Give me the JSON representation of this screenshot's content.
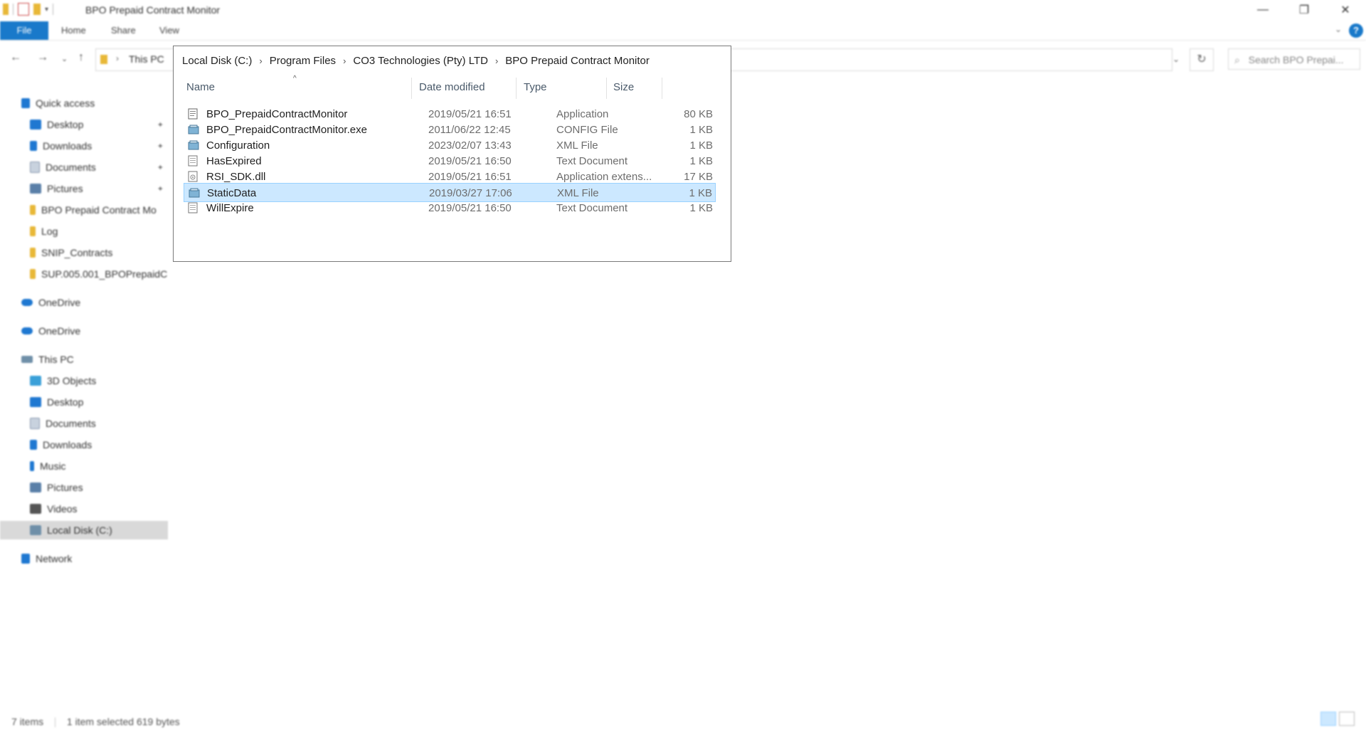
{
  "window": {
    "title": "BPO Prepaid Contract Monitor",
    "controls": [
      "—",
      "❐",
      "✕"
    ]
  },
  "ribbon": {
    "tabs": [
      "File",
      "Home",
      "Share",
      "View"
    ],
    "help": "?"
  },
  "address": {
    "this_pc": "This PC",
    "search_placeholder": "Search BPO Prepai..."
  },
  "sidebar": {
    "quick_access": "Quick access",
    "quick_items": [
      {
        "label": "Desktop",
        "icon": "desktop-icon",
        "color": "#1f78d1",
        "pinned": true
      },
      {
        "label": "Downloads",
        "icon": "download-icon",
        "color": "#1f78d1",
        "pinned": true
      },
      {
        "label": "Documents",
        "icon": "documents-icon",
        "color": "#8a9bb0",
        "pinned": true
      },
      {
        "label": "Pictures",
        "icon": "pictures-icon",
        "color": "#5a7fa8",
        "pinned": true
      },
      {
        "label": "BPO Prepaid Contract Mo",
        "icon": "folder-icon",
        "color": "#e8b838",
        "pinned": false
      },
      {
        "label": "Log",
        "icon": "folder-icon",
        "color": "#e8b838",
        "pinned": false
      },
      {
        "label": "SNIP_Contracts",
        "icon": "folder-icon",
        "color": "#e8b838",
        "pinned": false
      },
      {
        "label": "SUP.005.001_BPOPrepaidC",
        "icon": "folder-icon",
        "color": "#e8b838",
        "pinned": false
      }
    ],
    "onedrive_1": "OneDrive",
    "onedrive_2": "OneDrive",
    "this_pc": "This PC",
    "pc_items": [
      {
        "label": "3D Objects",
        "icon": "3d-objects-icon",
        "color": "#3aa0d8"
      },
      {
        "label": "Desktop",
        "icon": "desktop-icon",
        "color": "#1f78d1"
      },
      {
        "label": "Documents",
        "icon": "documents-icon",
        "color": "#8a9bb0"
      },
      {
        "label": "Downloads",
        "icon": "download-icon",
        "color": "#1f78d1"
      },
      {
        "label": "Music",
        "icon": "music-icon",
        "color": "#1f78d1"
      },
      {
        "label": "Pictures",
        "icon": "pictures-icon",
        "color": "#5a7fa8"
      },
      {
        "label": "Videos",
        "icon": "videos-icon",
        "color": "#555555"
      },
      {
        "label": "Local Disk (C:)",
        "icon": "local-disk-icon",
        "color": "#6f8fa8"
      }
    ],
    "network": "Network"
  },
  "breadcrumb": [
    "Local Disk (C:)",
    "Program Files",
    "CO3 Technologies (Pty) LTD",
    "BPO Prepaid Contract Monitor"
  ],
  "columns": {
    "name": "Name",
    "date": "Date modified",
    "type": "Type",
    "size": "Size"
  },
  "files": [
    {
      "name": "BPO_PrepaidContractMonitor",
      "date": "2019/05/21 16:51",
      "type": "Application",
      "size": "80 KB",
      "icon": "application-icon",
      "selected": false
    },
    {
      "name": "BPO_PrepaidContractMonitor.exe",
      "date": "2011/06/22 12:45",
      "type": "CONFIG File",
      "size": "1 KB",
      "icon": "config-file-icon",
      "selected": false
    },
    {
      "name": "Configuration",
      "date": "2023/02/07 13:43",
      "type": "XML File",
      "size": "1 KB",
      "icon": "xml-file-icon",
      "selected": false
    },
    {
      "name": "HasExpired",
      "date": "2019/05/21 16:50",
      "type": "Text Document",
      "size": "1 KB",
      "icon": "text-document-icon",
      "selected": false
    },
    {
      "name": "RSI_SDK.dll",
      "date": "2019/05/21 16:51",
      "type": "Application extens...",
      "size": "17 KB",
      "icon": "dll-file-icon",
      "selected": false
    },
    {
      "name": "StaticData",
      "date": "2019/03/27 17:06",
      "type": "XML File",
      "size": "1 KB",
      "icon": "xml-file-icon",
      "selected": true
    },
    {
      "name": "WillExpire",
      "date": "2019/05/21 16:50",
      "type": "Text Document",
      "size": "1 KB",
      "icon": "text-document-icon",
      "selected": false
    }
  ],
  "status": {
    "count": "7 items",
    "selection": "1 item selected  619 bytes"
  },
  "colors": {
    "accent": "#1979ca",
    "selection_bg": "#cce8ff",
    "selection_border": "#99d1ff"
  }
}
